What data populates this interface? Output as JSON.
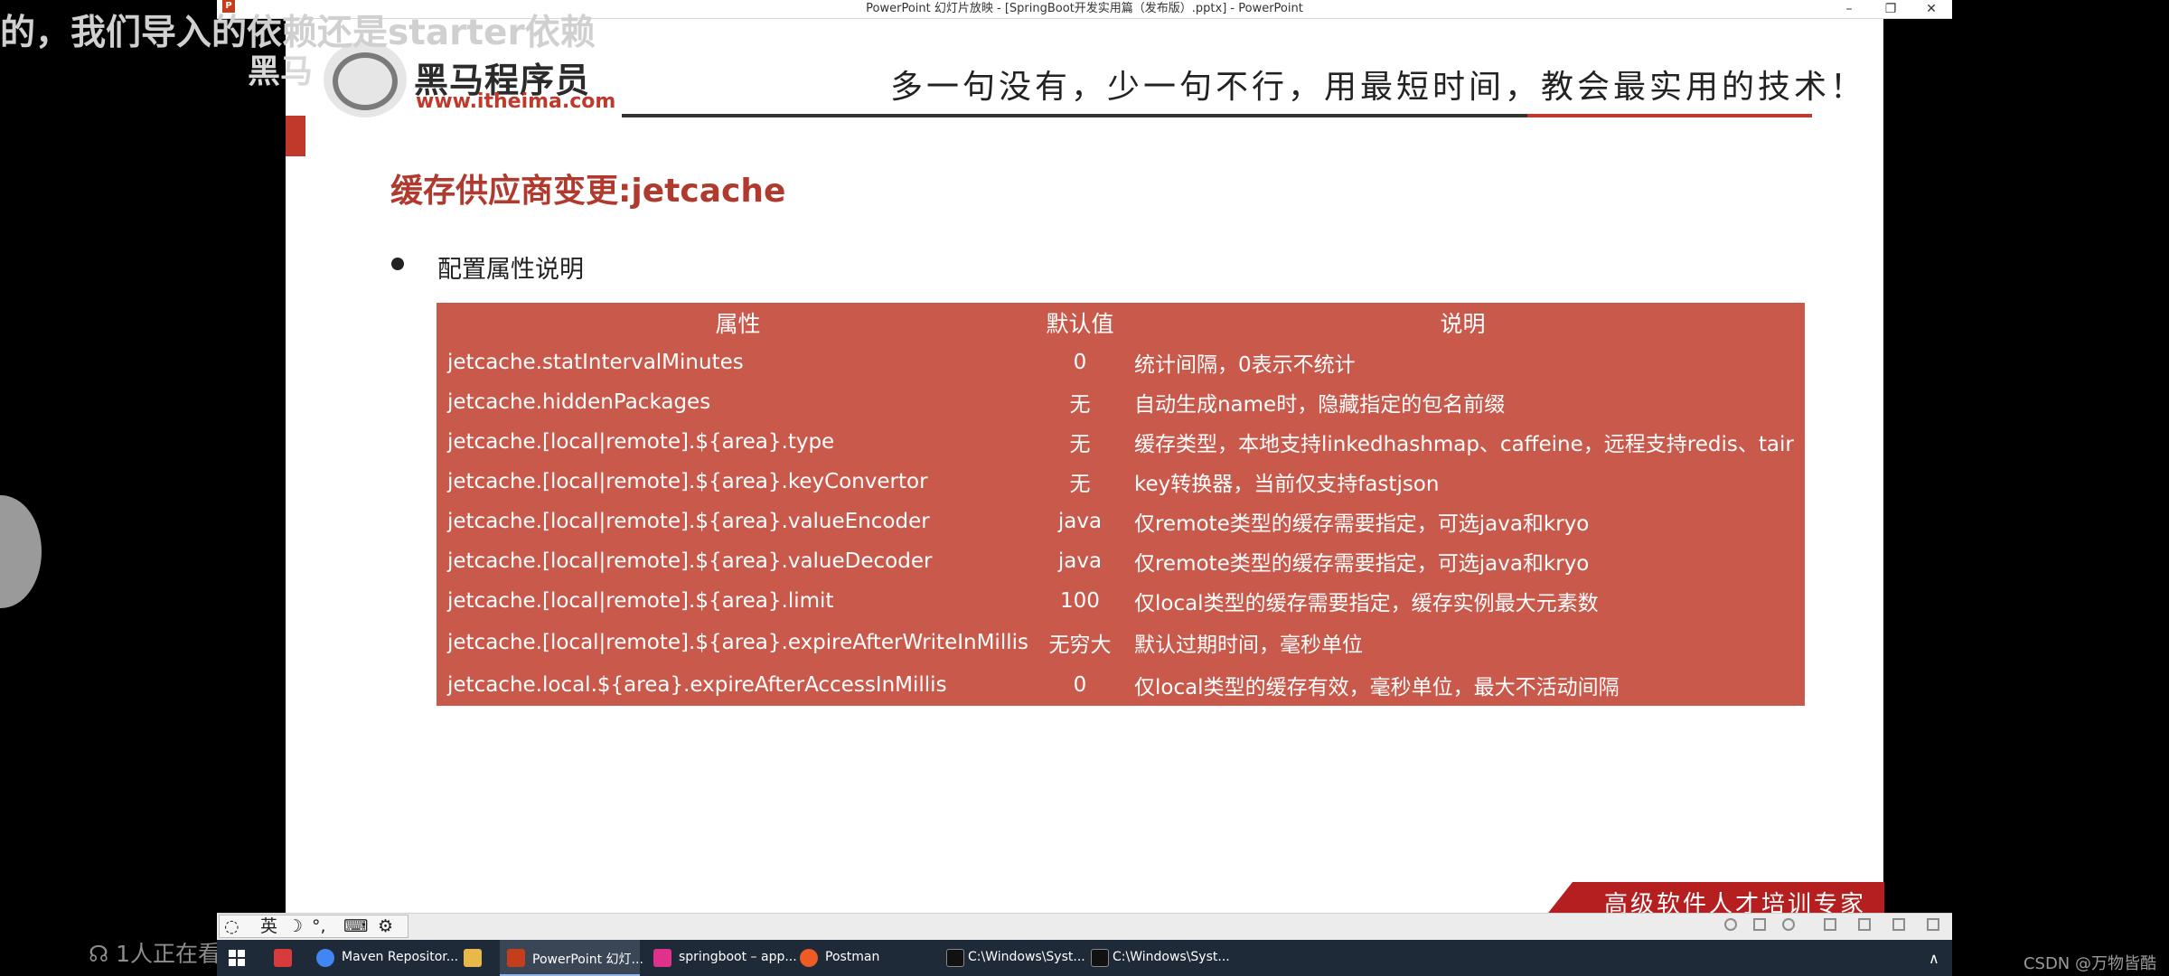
{
  "window": {
    "title": "PowerPoint 幻灯片放映 - [SpringBoot开发实用篇（发布版）.pptx] - PowerPoint",
    "app_icon_letter": "P",
    "minimize": "–",
    "restore": "❐",
    "close": "✕"
  },
  "overlay": {
    "subtitle": "的，我们导入的依赖还是starter依赖",
    "watermark": "黑马",
    "viewer_count": "1人正在看",
    "csdn": "CSDN @万物皆酷"
  },
  "slide": {
    "logo_cn": "黑马程序员",
    "logo_url": "www.itheima.com",
    "slogan": "多一句没有，少一句不行，用最短时间，教会最实用的技术！",
    "title": "缓存供应商变更:jetcache",
    "bullet": "配置属性说明",
    "table": {
      "headers": [
        "属性",
        "默认值",
        "说明"
      ],
      "rows": [
        [
          "jetcache.statIntervalMinutes",
          "0",
          "统计间隔，0表示不统计"
        ],
        [
          "jetcache.hiddenPackages",
          "无",
          "自动生成name时，隐藏指定的包名前缀"
        ],
        [
          "jetcache.[local|remote].${area}.type",
          "无",
          "缓存类型，本地支持linkedhashmap、caffeine，远程支持redis、tair"
        ],
        [
          "jetcache.[local|remote].${area}.keyConvertor",
          "无",
          "key转换器，当前仅支持fastjson"
        ],
        [
          "jetcache.[local|remote].${area}.valueEncoder",
          "java",
          "仅remote类型的缓存需要指定，可选java和kryo"
        ],
        [
          "jetcache.[local|remote].${area}.valueDecoder",
          "java",
          "仅remote类型的缓存需要指定，可选java和kryo"
        ],
        [
          "jetcache.[local|remote].${area}.limit",
          "100",
          "仅local类型的缓存需要指定，缓存实例最大元素数"
        ],
        [
          "jetcache.[local|remote].${area}.expireAfterWriteInMillis",
          "无穷大",
          "默认过期时间，毫秒单位"
        ],
        [
          "jetcache.local.${area}.expireAfterAccessInMillis",
          "0",
          "仅local类型的缓存有效，毫秒单位，最大不活动间隔"
        ]
      ]
    },
    "banner": "高级软件人才培训专家"
  },
  "ime": {
    "lang": "英",
    "moon": "☽",
    "punct": "°,",
    "keyboard": "⌨",
    "settings": "⚙"
  },
  "taskbar": {
    "start_icon": "windows-start-icon",
    "items": [
      {
        "label": "Maven Repositor...",
        "color": "#4285f4"
      },
      {
        "label": "PowerPoint 幻灯...",
        "color": "#c43e1c"
      },
      {
        "label": "springboot – app...",
        "color": "#e0318c"
      },
      {
        "label": "Postman",
        "color": "#ef5b25"
      },
      {
        "label": "C:\\Windows\\Syst...",
        "color": "#111111"
      },
      {
        "label": "C:\\Windows\\Syst...",
        "color": "#111111"
      }
    ],
    "tray_chevron": "∧"
  },
  "colors": {
    "table_bg": "#c9594b",
    "title_red": "#b03a2e",
    "accent_red": "#c0392b",
    "taskbar": "#1f2a38"
  }
}
